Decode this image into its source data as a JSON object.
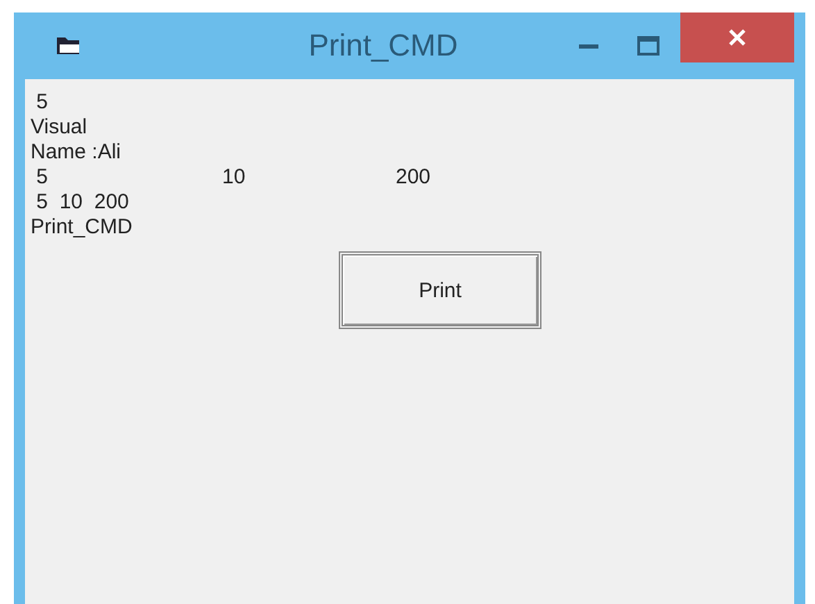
{
  "window": {
    "title": "Print_CMD"
  },
  "output": [
    {
      "kind": "text",
      "text": " 5"
    },
    {
      "kind": "text",
      "text": "Visual"
    },
    {
      "kind": "text",
      "text": "Name :Ali"
    },
    {
      "kind": "zones",
      "cells": [
        " 5",
        "10",
        "200"
      ]
    },
    {
      "kind": "text",
      "text": " 5  10  200"
    },
    {
      "kind": "text",
      "text": "Print_CMD"
    }
  ],
  "button": {
    "label": "Print"
  }
}
